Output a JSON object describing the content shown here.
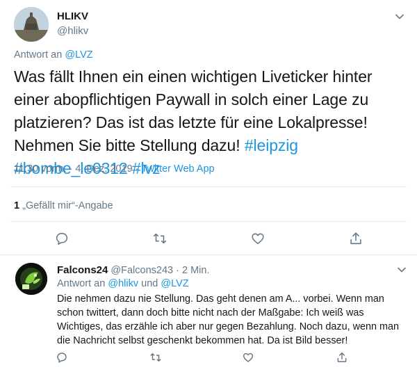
{
  "main_tweet": {
    "display_name": "HLIKV",
    "handle": "@hlikv",
    "reply_prefix": "Antwort an",
    "reply_to": "@LVZ",
    "text_plain": "Was fällt Ihnen ein einen wichtigen Liveticker hinter einer abopflichtigen Paywall in solch einer Lage zu platzieren? Das ist das letzte für eine Lokalpresse! Nehmen Sie bitte Stellung dazu!",
    "hashtags": [
      "#leipzig",
      "#bombe_le0312",
      "#lvz"
    ],
    "time": "11:30 vorm.",
    "date": "4. Dez. 2019",
    "separator": "·",
    "source": "Twitter Web App",
    "likes_count": "1",
    "likes_label": "„Gefällt mir“-Angabe"
  },
  "reply_tweet": {
    "display_name": "Falcons24",
    "handle": "@Falcons243",
    "separator": "·",
    "age": "2 Min.",
    "reply_prefix": "Antwort an",
    "reply_to_1": "@hlikv",
    "reply_and": "und",
    "reply_to_2": "@LVZ",
    "text": "Die nehmen dazu nie Stellung. Das geht denen am A... vorbei. Wenn man schon twittert, dann doch bitte nicht nach der Maßgabe: Ich weiß was Wichtiges, das erzähle ich aber nur gegen Bezahlung. Noch dazu, wenn man die Nachricht selbst geschenkt bekommen hat. Da ist Bild besser!"
  },
  "icons": {
    "reply": "comment-icon",
    "retweet": "retweet-icon",
    "like": "heart-icon",
    "share": "share-icon",
    "menu": "chevron-down-icon"
  },
  "colors": {
    "link": "#1b95e0",
    "muted": "#657786",
    "text": "#14171a",
    "divider": "#e6ecf0"
  }
}
